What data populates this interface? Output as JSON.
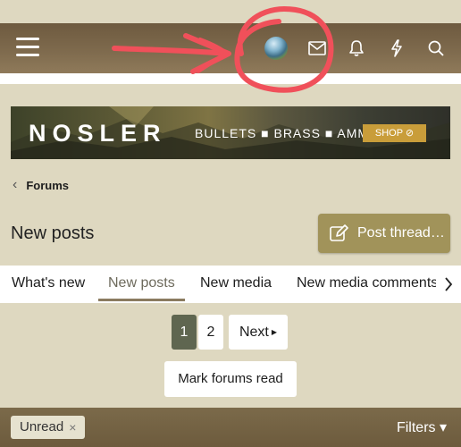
{
  "header": {
    "menu_icon": "hamburger-icon",
    "icons": [
      "avatar",
      "envelope-icon",
      "bell-icon",
      "lightning-icon",
      "search-icon"
    ]
  },
  "banner": {
    "logo": "NOSLER",
    "tagline": "BULLETS ■ BRASS ■ AMMO",
    "cta": "SHOP ⊘"
  },
  "breadcrumb": {
    "label": "Forums"
  },
  "page": {
    "title": "New posts",
    "post_thread_label": "Post thread…"
  },
  "tabs": [
    {
      "label": "What's new"
    },
    {
      "label": "New posts",
      "active": true
    },
    {
      "label": "New media"
    },
    {
      "label": "New media comments"
    }
  ],
  "pagination": {
    "current": "1",
    "page2": "2",
    "next_label": "Next"
  },
  "actions": {
    "mark_read": "Mark forums read"
  },
  "filter_bar": {
    "chip_label": "Unread",
    "chip_close": "×",
    "filters_label": "Filters ▾"
  },
  "colors": {
    "header_brown": "#7e6a4d",
    "page_bg": "#ded8c0",
    "accent_button": "#a1935a",
    "pager_active": "#5f6650",
    "annotation_red": "#f0505a"
  }
}
